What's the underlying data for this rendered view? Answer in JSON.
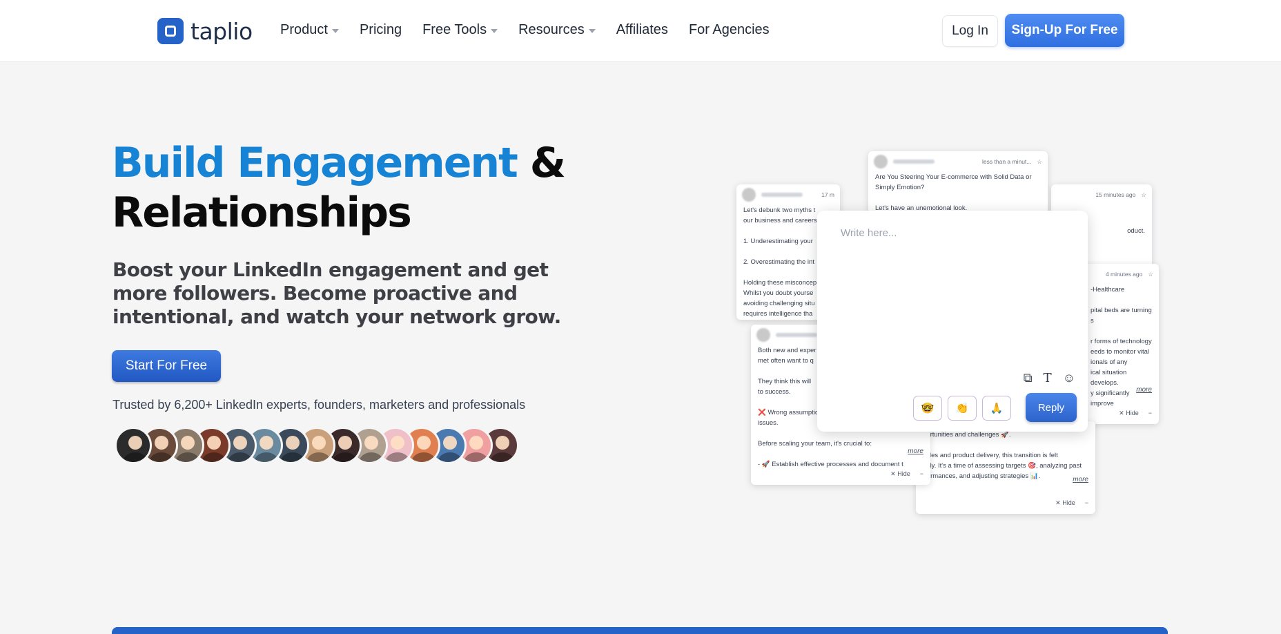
{
  "header": {
    "brand": "taplio",
    "nav": [
      {
        "label": "Product",
        "dropdown": true
      },
      {
        "label": "Pricing",
        "dropdown": false
      },
      {
        "label": "Free Tools",
        "dropdown": true
      },
      {
        "label": "Resources",
        "dropdown": true
      },
      {
        "label": "Affiliates",
        "dropdown": false
      },
      {
        "label": "For Agencies",
        "dropdown": false
      }
    ],
    "login_label": "Log In",
    "signup_label": "Sign-Up For Free"
  },
  "hero": {
    "headline_accent": "Build Engagement",
    "headline_rest": " & Relationships",
    "subheadline": "Boost your LinkedIn engagement and get more followers. Become proactive and intentional, and watch your network grow.",
    "cta_label": "Start For Free",
    "trusted_text": "Trusted by 6,200+ LinkedIn experts, founders, marketers and professionals"
  },
  "avatars": [
    "#2b2b2b",
    "#6a4a3a",
    "#8a7a6a",
    "#7a3b2b",
    "#4a5a6a",
    "#6a8aa0",
    "#3a4a5a",
    "#c9a07a",
    "#3a2a2a",
    "#b0a090",
    "#f0c0c8",
    "#e08050",
    "#4a7ab0",
    "#f0a0a0",
    "#5a3a3a"
  ],
  "cards": {
    "left": {
      "time": "17 m",
      "body": "Let's debunk two myths t\nour business and careers\n\n1. Underestimating your\n\n2. Overestimating the int\n\nHolding these misconcep\nWhilst you doubt yourse\navoiding challenging situ\nrequires intelligence tha\ndismiss these thoughts"
    },
    "top": {
      "time": "less than a minut...",
      "body": "Are You Steering Your E-commerce with Solid Data or\nSimply Emotion?\n\nLet's have an unemotional look."
    },
    "right_top": {
      "time": "15 minutes ago",
      "body": "oduct."
    },
    "right_mid": {
      "time": "4 minutes ago",
      "body": "-Healthcare\n\npital beds are turning\ns\n\nr forms of technology\needs to monitor vital\nionals of any\nical situation develops.\ny significantly improve",
      "more": "more",
      "hide": "✕  Hide"
    },
    "bottom_left": {
      "body": "Both new and exper\nmet often want to q\n\nThey think this will\nto success.\n\n❌ Wrong assumptic\nissues.\n\nBefore scaling your team, it's crucial to:\n\n- 🚀 Establish effective processes and document t",
      "more": "more",
      "hide": "✕  Hide"
    },
    "bottom_right": {
      "body": "portunities and challenges 🚀.\n\nsales and product delivery, this transition is felt\neply. It's a time of assessing targets 🎯, analyzing past\nrformances, and adjusting strategies 📊.",
      "more": "more",
      "hide": "✕  Hide"
    }
  },
  "editor": {
    "placeholder": "Write here...",
    "emoji_buttons": [
      "🤓",
      "👏",
      "🙏"
    ],
    "reply_label": "Reply"
  }
}
